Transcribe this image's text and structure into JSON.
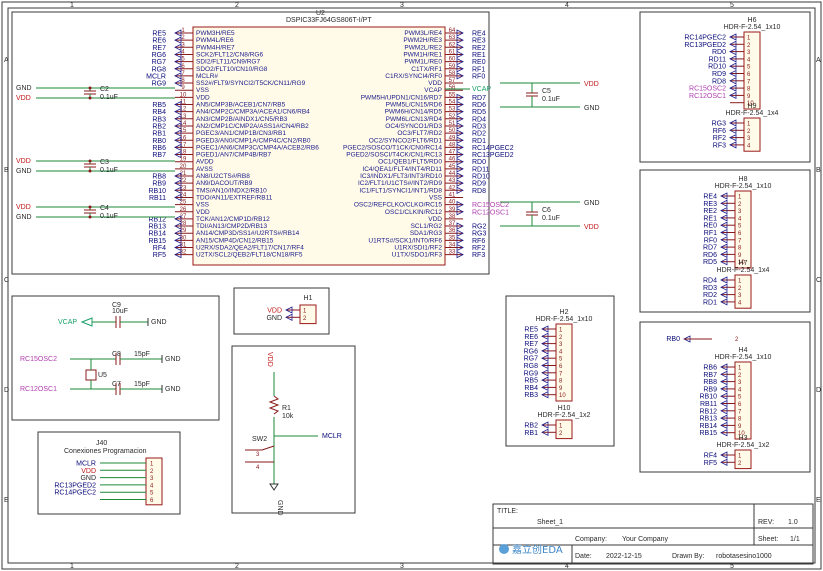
{
  "u2": {
    "ref": "U2",
    "part": "DSPIC33FJ64GS806T-I/PT",
    "left_pins": [
      {
        "n": "1",
        "name": "PWM3H/RE5",
        "net": "RE5"
      },
      {
        "n": "2",
        "name": "PWM4L/RE6",
        "net": "RE6"
      },
      {
        "n": "3",
        "name": "PWM4H/RE7",
        "net": "RE7"
      },
      {
        "n": "4",
        "name": "SCK2/FLT12/CN8/RG6",
        "net": "RG6"
      },
      {
        "n": "5",
        "name": "SDI2/FLT11/CN9/RG7",
        "net": "RG7"
      },
      {
        "n": "6",
        "name": "SDO2/FLT10/CN10/RG8",
        "net": "RG8"
      },
      {
        "n": "7",
        "name": "MCLR#",
        "net": "MCLR"
      },
      {
        "n": "8",
        "name": "SS2#/FLT9/SYNCI2/T5CK/CN11/RG9",
        "net": "RG9"
      },
      {
        "n": "9",
        "name": "VSS",
        "net": ""
      },
      {
        "n": "10",
        "name": "VDD",
        "net": ""
      },
      {
        "n": "11",
        "name": "AN5/CMP3B/ACEB1/CN7/RB5",
        "net": "RB5"
      },
      {
        "n": "12",
        "name": "AN4/CMP2C/CMP3A/ACEA1/CN6/RB4",
        "net": "RB4"
      },
      {
        "n": "13",
        "name": "AN3/CMP2B/AINDX1/CN5/RB3",
        "net": "RB3"
      },
      {
        "n": "14",
        "name": "AN2/CMP1C/CMP2A/ASS1#/CN4/RB2",
        "net": "RB2"
      },
      {
        "n": "15",
        "name": "PGEC3/AN1/CMP1B/CN3/RB1",
        "net": "RB1"
      },
      {
        "n": "16",
        "name": "PGED3/AN0/CMP1A/CMP4C/CN2/RB0",
        "net": "RB0"
      },
      {
        "n": "17",
        "name": "PGEC1/AN6/CMP3C/CMP4A/ACEB2/RB6",
        "net": "RB6"
      },
      {
        "n": "18",
        "name": "PGED1/AN7/CMP4B/RB7",
        "net": "RB7"
      },
      {
        "n": "19",
        "name": "AVDD",
        "net": ""
      },
      {
        "n": "20",
        "name": "AVSS",
        "net": ""
      },
      {
        "n": "21",
        "name": "AN8/U2CTS#/RB8",
        "net": "RB8"
      },
      {
        "n": "22",
        "name": "AN9/DACOUT/RB9",
        "net": "RB9"
      },
      {
        "n": "23",
        "name": "TMS/AN10/INDX2/RB10",
        "net": "RB10"
      },
      {
        "n": "24",
        "name": "TDO/AN11/EXTREF/RB11",
        "net": "RB11"
      },
      {
        "n": "25",
        "name": "VSS",
        "net": ""
      },
      {
        "n": "26",
        "name": "VDD",
        "net": ""
      },
      {
        "n": "27",
        "name": "TCK/AN12/CMP1D/RB12",
        "net": "RB12"
      },
      {
        "n": "28",
        "name": "TDI/AN13/CMP2D/RB13",
        "net": "RB13"
      },
      {
        "n": "29",
        "name": "AN14/CMP3D/SS1#/U2RTS#/RB14",
        "net": "RB14"
      },
      {
        "n": "30",
        "name": "AN15/CMP4D/CN12/RB15",
        "net": "RB15"
      },
      {
        "n": "31",
        "name": "U2RX/SDA2/QEA2/FLT17/CN17/RF4",
        "net": "RF4"
      },
      {
        "n": "32",
        "name": "U2TX/SCL2/QEB2/FLT18/CN18/RF5",
        "net": "RF5"
      }
    ],
    "right_pins": [
      {
        "n": "64",
        "name": "PWM3L/RE4",
        "net": "RE4"
      },
      {
        "n": "63",
        "name": "PWM2H/RE3",
        "net": "RE3"
      },
      {
        "n": "62",
        "name": "PWM2L/RE2",
        "net": "RE2"
      },
      {
        "n": "61",
        "name": "PWM1H/RE1",
        "net": "RE1"
      },
      {
        "n": "60",
        "name": "PWM1L/RE0",
        "net": "RE0"
      },
      {
        "n": "59",
        "name": "C1TX/RF1",
        "net": "RF1"
      },
      {
        "n": "58",
        "name": "C1RX/SYNCI4/RF0",
        "net": "RF0"
      },
      {
        "n": "57",
        "name": "VDD",
        "net": ""
      },
      {
        "n": "56",
        "name": "VCAP",
        "net": "VCAP"
      },
      {
        "n": "55",
        "name": "PWM5H/UPDN1/CN16/RD7",
        "net": "RD7"
      },
      {
        "n": "54",
        "name": "PWM5L/CN15/RD6",
        "net": "RD6"
      },
      {
        "n": "53",
        "name": "PWM6H/CN14/RD5",
        "net": "RD5"
      },
      {
        "n": "52",
        "name": "PWM6L/CN13/RD4",
        "net": "RD4"
      },
      {
        "n": "51",
        "name": "OC4/SYNCO1/RD3",
        "net": "RD3"
      },
      {
        "n": "50",
        "name": "OC3/FLT7/RD2",
        "net": "RD2"
      },
      {
        "n": "49",
        "name": "OC2/SYNCO2/FLT6/RD1",
        "net": "RD1"
      },
      {
        "n": "48",
        "name": "PGEC2/SOSCO/T1CK/CN0/RC14",
        "net": "RC14PGEC2"
      },
      {
        "n": "47",
        "name": "PGED2/SOSCI/T4CK/CN1/RC13",
        "net": "RC13PGED2"
      },
      {
        "n": "46",
        "name": "OC1/QEB1/FLT5/RD0",
        "net": "RD0"
      },
      {
        "n": "45",
        "name": "IC4/QEA1/FLT4/INT4/RD11",
        "net": "RD11"
      },
      {
        "n": "44",
        "name": "IC3/INDX1/FLT3/INT3/RD10",
        "net": "RD10"
      },
      {
        "n": "43",
        "name": "IC2/FLT1/U1CTS#/INT2/RD9",
        "net": "RD9"
      },
      {
        "n": "42",
        "name": "IC1/FLT1/SYNCI1/INT1/RD8",
        "net": "RD8"
      },
      {
        "n": "41",
        "name": "VSS",
        "net": ""
      },
      {
        "n": "40",
        "name": "OSC2/REFCLKO/CLKO/RC15",
        "net": "RC15OSC2"
      },
      {
        "n": "39",
        "name": "OSC1/CLKIN/RC12",
        "net": "RC12OSC1"
      },
      {
        "n": "38",
        "name": "VDD",
        "net": ""
      },
      {
        "n": "37",
        "name": "SCL1/RG2",
        "net": "RG2"
      },
      {
        "n": "36",
        "name": "SDA1/RG3",
        "net": "RG3"
      },
      {
        "n": "35",
        "name": "U1RTS#/SCK1/INT0/RF6",
        "net": "RF6"
      },
      {
        "n": "34",
        "name": "U1RX/SDI1/RF2",
        "net": "RF2"
      },
      {
        "n": "33",
        "name": "U1TX/SDO1/RF3",
        "net": "RF3"
      }
    ]
  },
  "mcu_caps": [
    {
      "ref": "C2",
      "val": "0.1uF",
      "top": "GND",
      "bot": "VDD"
    },
    {
      "ref": "C3",
      "val": "0.1uF",
      "top": "VDD",
      "bot": "GND"
    },
    {
      "ref": "C4",
      "val": "0.1uF",
      "top": "VDD",
      "bot": "GND"
    }
  ],
  "right_caps": [
    {
      "ref": "C5",
      "val": "0.1uF",
      "left": "VDD",
      "right": "GND"
    },
    {
      "ref": "C6",
      "val": "0.1uF",
      "left": "GND",
      "right": "VDD"
    }
  ],
  "vcap_label": "VCAP",
  "headers": {
    "h6": {
      "ref": "H6",
      "part": "HDR-F-2.54_1x10",
      "nets": [
        "RC14PGEC2",
        "RC13PGED2",
        "RD0",
        "RD11",
        "RD10",
        "RD9",
        "RD8",
        "RC15OSC2",
        "RC12OSC1",
        ""
      ],
      "pins": [
        "1",
        "2",
        "3",
        "4",
        "5",
        "6",
        "7",
        "8",
        "9",
        "10"
      ]
    },
    "h9": {
      "ref": "H9",
      "part": "HDR-F-2.54_1x4",
      "nets": [
        "RG3",
        "RF6",
        "RF2",
        "RF3"
      ],
      "pins": [
        "1",
        "2",
        "3",
        "4"
      ]
    },
    "h8": {
      "ref": "H8",
      "part": "HDR-F-2.54_1x10",
      "nets": [
        "RE4",
        "RE3",
        "RE2",
        "RE1",
        "RE0",
        "RF1",
        "RF0",
        "RD7",
        "RD6",
        "RD5"
      ],
      "pins": [
        "1",
        "2",
        "3",
        "4",
        "5",
        "6",
        "7",
        "8",
        "9",
        "10"
      ]
    },
    "h7": {
      "ref": "H7",
      "part": "HDR-F-2.54_1x4",
      "nets": [
        "RD4",
        "RD3",
        "RD2",
        "RD1"
      ],
      "pins": [
        "1",
        "2",
        "3",
        "4"
      ]
    },
    "h2": {
      "ref": "H2",
      "part": "HDR-F-2.54_1x10",
      "nets": [
        "RE5",
        "RE6",
        "RE7",
        "RG6",
        "RG7",
        "RG8",
        "RG9",
        "RB5",
        "RB4",
        "RB3"
      ],
      "pins": [
        "1",
        "2",
        "3",
        "4",
        "5",
        "6",
        "7",
        "8",
        "9",
        "10"
      ]
    },
    "h10": {
      "ref": "H10",
      "part": "HDR-F-2.54_1x2",
      "nets": [
        "RB2",
        "RB1"
      ],
      "pins": [
        "1",
        "2"
      ]
    },
    "rb0": {
      "net": "RB0",
      "pin": "2"
    },
    "h4": {
      "ref": "H4",
      "part": "HDR-F-2.54_1x10",
      "nets": [
        "RB6",
        "RB7",
        "RB8",
        "RB9",
        "RB10",
        "RB11",
        "RB12",
        "RB13",
        "RB14",
        "RB15"
      ],
      "pins": [
        "1",
        "2",
        "3",
        "4",
        "5",
        "6",
        "7",
        "8",
        "9",
        "10"
      ]
    },
    "h3": {
      "ref": "H3",
      "part": "HDR-F-2.54_1x2",
      "nets": [
        "RF4",
        "RF5"
      ],
      "pins": [
        "1",
        "2"
      ]
    },
    "h1": {
      "ref": "H1",
      "part": "",
      "nets": [
        "VDD",
        "GND"
      ],
      "pins": [
        "1",
        "2"
      ]
    }
  },
  "vcap_block": {
    "ref": "C9",
    "val": "10uF",
    "net": "VCAP",
    "gnd": "GND"
  },
  "osc_block": {
    "c8": {
      "ref": "C8",
      "val": "15pF"
    },
    "c7": {
      "ref": "C7",
      "val": "15pF"
    },
    "xtal": "U5",
    "net1": "RC15OSC2",
    "net2": "RC12OSC1",
    "gnd": "GND"
  },
  "reset_block": {
    "vdd": "VDD",
    "res_ref": "R1",
    "res_val": "10k",
    "sw": "SW2",
    "net": "MCLR",
    "gnd": "GND",
    "sw_pins": [
      "1",
      "2",
      "3",
      "4"
    ]
  },
  "j40": {
    "ref": "J40",
    "title": "Conexiones Programacion",
    "nets": [
      "MCLR",
      "VDD",
      "GND",
      "RC13PGED2",
      "RC14PGEC2",
      ""
    ],
    "pins": [
      "1",
      "2",
      "3",
      "4",
      "5",
      "6"
    ]
  },
  "title_block": {
    "title_label": "TITLE:",
    "title": "Sheet_1",
    "rev_label": "REV:",
    "rev": "1.0",
    "company_label": "Company:",
    "company": "Your Company",
    "sheet_label": "Sheet:",
    "sheet": "1/1",
    "date_label": "Date:",
    "date": "2022-12-15",
    "drawn_label": "Drawn By:",
    "drawn": "robotasesino1000",
    "logo": "嘉立创EDA"
  },
  "frame": {
    "cols": [
      "1",
      "2",
      "3",
      "4",
      "5"
    ],
    "rows": [
      "A",
      "B",
      "C",
      "D",
      "E"
    ]
  },
  "colors": {
    "wire": "#1d8a3a",
    "net_blue": "#0a0a7a",
    "net_red": "#c01818",
    "pink": "#b040b0",
    "vcap": "#18a068"
  }
}
